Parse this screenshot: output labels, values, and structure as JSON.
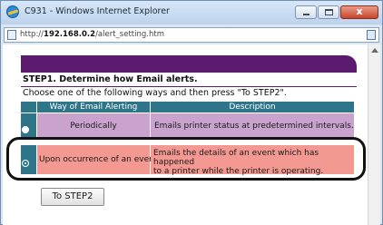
{
  "window": {
    "title": "C931 - Windows Internet Explorer",
    "close_label": "x"
  },
  "address_bar": {
    "url_prefix": "http://",
    "url_host": "192.168.0.2",
    "url_path": "/alert_setting.htm"
  },
  "page": {
    "step_title": "STEP1. Determine how Email alerts.",
    "instruction": "Choose one of the following ways and then press \"To STEP2\".",
    "table": {
      "headers": {
        "way": "Way of Email Alerting",
        "description": "Description"
      },
      "rows": [
        {
          "way": "Periodically",
          "description": "Emails printer status at predetermined intervals.",
          "selected": false
        },
        {
          "way": "Upon occurrence of an event",
          "description_line1": "Emails the details of an event which has happened",
          "description_line2": "to a printer while the printer is operating.",
          "selected": true
        }
      ]
    },
    "next_button": "To STEP2"
  },
  "colors": {
    "banner": "#5b1a6e",
    "header": "#2f7589",
    "row_periodic": "#c9a3cd",
    "row_event": "#f49892"
  }
}
